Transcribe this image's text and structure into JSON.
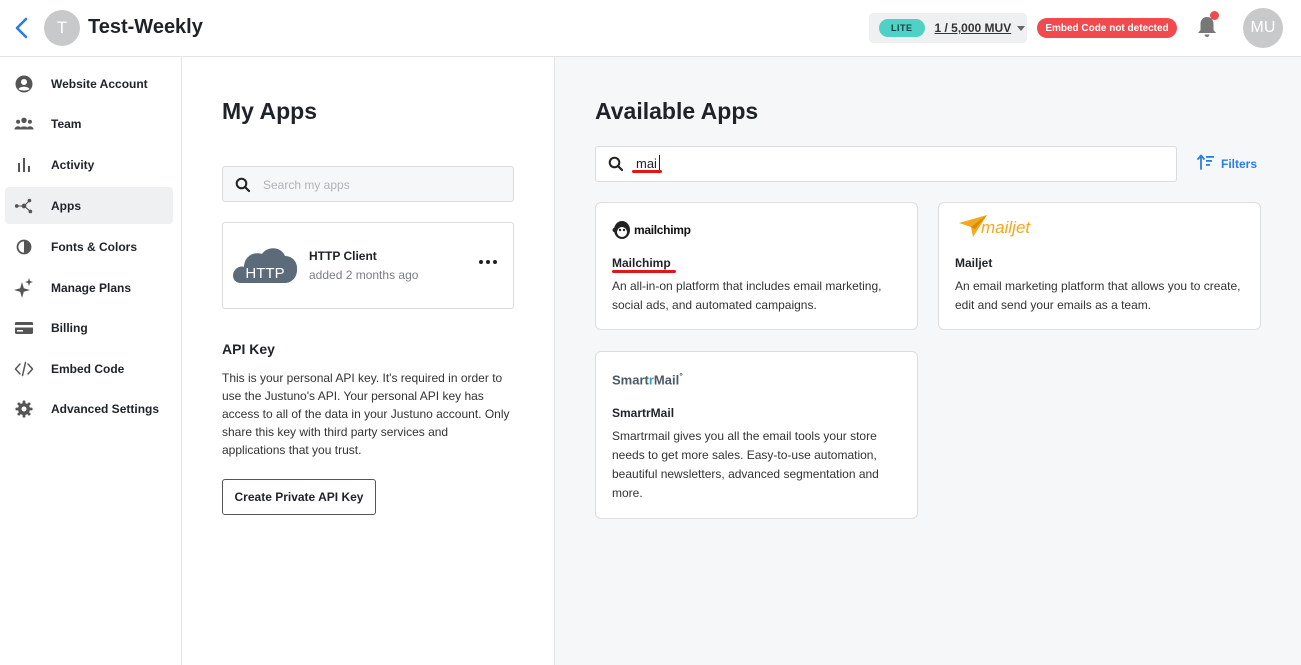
{
  "header": {
    "site_initial": "T",
    "site_name": "Test-Weekly",
    "plan_badge": "LITE",
    "muv_usage": "1 / 5,000 MUV",
    "embed_status": "Embed Code not detected",
    "user_initials": "MU"
  },
  "sidebar": {
    "items": [
      {
        "label": "Website Account",
        "icon": "account-circle-icon"
      },
      {
        "label": "Team",
        "icon": "team-icon"
      },
      {
        "label": "Activity",
        "icon": "bar-chart-icon"
      },
      {
        "label": "Apps",
        "icon": "apps-hub-icon",
        "active": true
      },
      {
        "label": "Fonts & Colors",
        "icon": "contrast-icon"
      },
      {
        "label": "Manage Plans",
        "icon": "sparkle-icon"
      },
      {
        "label": "Billing",
        "icon": "credit-card-icon"
      },
      {
        "label": "Embed Code",
        "icon": "code-icon"
      },
      {
        "label": "Advanced Settings",
        "icon": "gear-icon"
      }
    ]
  },
  "my_apps": {
    "title": "My Apps",
    "search_placeholder": "Search my apps",
    "installed": [
      {
        "logo_text": "HTTP",
        "name": "HTTP Client",
        "added": "added 2 months ago"
      }
    ],
    "api_key": {
      "title": "API Key",
      "description": "This is your personal API key. It's required in order to use the Justuno's API. Your personal API key has access to all of the data in your Justuno account. Only share this key with third party services and applications that you trust.",
      "button": "Create Private API Key"
    }
  },
  "available_apps": {
    "title": "Available Apps",
    "search_value": "mai",
    "filters_label": "Filters",
    "apps": [
      {
        "logo_text": "mailchimp",
        "name": "Mailchimp",
        "description": "An all-in-on platform that includes email marketing, social ads, and automated campaigns."
      },
      {
        "logo_text": "mailjet",
        "name": "Mailjet",
        "description": "An email marketing platform that allows you to create, edit and send your emails as a team."
      },
      {
        "logo_text_a": "Smart",
        "logo_text_b": "r",
        "logo_text_c": "Mail",
        "name": "SmartrMail",
        "description": "Smartrmail gives you all the email tools your store needs to get more sales. Easy-to-use automation, beautiful newsletters, advanced segmentation and more."
      }
    ]
  },
  "colors": {
    "accent_blue": "#2a7de1",
    "lite_teal": "#4fd1c5",
    "alert_red": "#f0494e",
    "annotation_red": "#e0161b",
    "mailjet_orange": "#f4a81b"
  }
}
